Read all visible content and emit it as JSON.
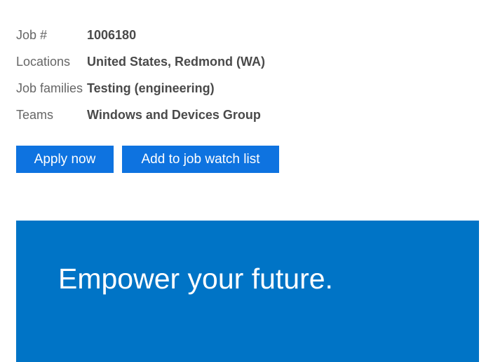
{
  "job_details": [
    {
      "label": "Job #",
      "value": "1006180"
    },
    {
      "label": "Locations",
      "value": "United States, Redmond (WA)"
    },
    {
      "label": "Job families",
      "value": "Testing (engineering)"
    },
    {
      "label": "Teams",
      "value": "Windows and Devices Group"
    }
  ],
  "actions": {
    "apply_label": "Apply now",
    "watch_label": "Add to job watch list"
  },
  "banner": {
    "headline": "Empower your future."
  },
  "colors": {
    "button_blue": "#0e73e0",
    "banner_blue": "#0074c6",
    "label_gray": "#666666",
    "value_gray": "#4a4a4a"
  }
}
